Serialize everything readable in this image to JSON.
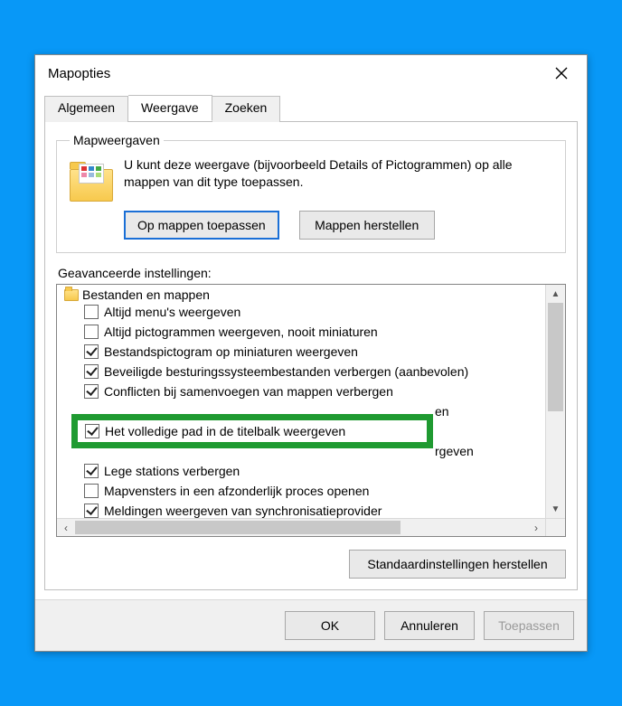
{
  "window": {
    "title": "Mapopties"
  },
  "tabs": [
    {
      "label": "Algemeen",
      "active": false
    },
    {
      "label": "Weergave",
      "active": true
    },
    {
      "label": "Zoeken",
      "active": false
    }
  ],
  "folderViews": {
    "legend": "Mapweergaven",
    "description": "U kunt deze weergave (bijvoorbeeld Details of Pictogrammen) op alle mappen van dit type toepassen.",
    "apply": "Op mappen toepassen",
    "reset": "Mappen herstellen"
  },
  "advanced": {
    "label": "Geavanceerde instellingen:",
    "header": "Bestanden en mappen",
    "items": [
      {
        "checked": false,
        "label": "Altijd menu's weergeven"
      },
      {
        "checked": false,
        "label": "Altijd pictogrammen weergeven, nooit miniaturen"
      },
      {
        "checked": true,
        "label": "Bestandspictogram op miniaturen weergeven"
      },
      {
        "checked": true,
        "label": "Beveiligde besturingssysteembestanden verbergen (aanbevolen)"
      },
      {
        "checked": true,
        "label": "Conflicten bij samenvoegen van mappen verbergen"
      },
      {
        "checked": true,
        "label": "Het volledige pad in de titelbalk weergeven",
        "highlighted": true
      },
      {
        "checked": true,
        "label": "Lege stations verbergen"
      },
      {
        "checked": false,
        "label": "Mapvensters in een afzonderlijk proces openen"
      },
      {
        "checked": true,
        "label": "Meldingen weergeven van synchronisatieprovider"
      }
    ],
    "restoreDefaults": "Standaardinstellingen herstellen",
    "peek_tail": "rgeven",
    "peek_above": "en"
  },
  "footer": {
    "ok": "OK",
    "cancel": "Annuleren",
    "apply": "Toepassen"
  }
}
